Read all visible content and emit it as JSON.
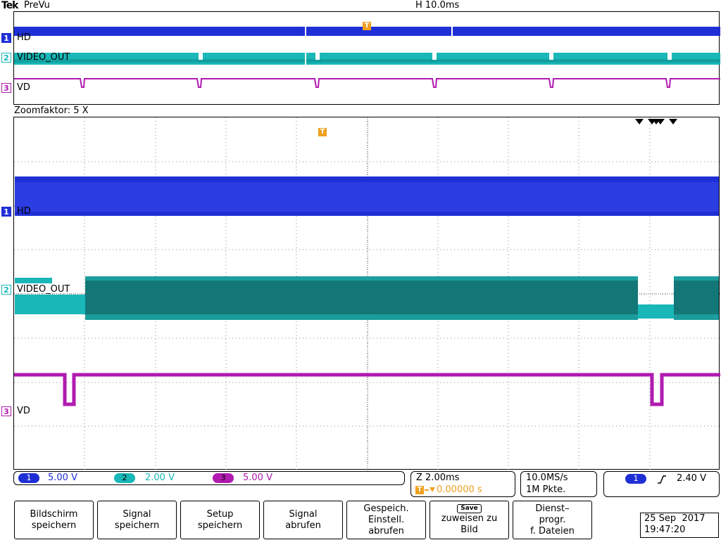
{
  "header": {
    "brand": "Tek",
    "mode": "PreVu",
    "horizontal_scale": "H 10.0ms"
  },
  "overview": {
    "channels": [
      {
        "badge": "1",
        "label": "HD",
        "color": "#1f2fd6"
      },
      {
        "badge": "2",
        "label": "VIDEO_OUT",
        "color": "#19b7b7"
      },
      {
        "badge": "3",
        "label": "VD",
        "color": "#b01ab0"
      }
    ],
    "trigger_marker": "T"
  },
  "zoom": {
    "label": "Zoomfaktor: 5 X",
    "trigger_marker": "T",
    "channels": [
      {
        "badge": "1",
        "label": "HD",
        "color": "#1f2fd6"
      },
      {
        "badge": "2",
        "label": "VIDEO_OUT",
        "color": "#19b7b7"
      },
      {
        "badge": "3",
        "label": "VD",
        "color": "#b01ab0"
      }
    ]
  },
  "channel_bar": [
    {
      "num": "1",
      "value": "5.00 V",
      "color": "#1f2fd6"
    },
    {
      "num": "2",
      "value": "2.00 V",
      "color": "#19b7b7"
    },
    {
      "num": "3",
      "value": "5.00 V",
      "color": "#b01ab0"
    }
  ],
  "zoom_box": {
    "line1": "Z 2.00ms",
    "trigger_marker": "T",
    "line2": "0.00000 s",
    "line2_color": "#f0a020"
  },
  "sample_box": {
    "rate": "10.0MS/s",
    "points": "1M Pkte."
  },
  "trigger_box": {
    "channel": "1",
    "slope_icon": "rising-edge-icon",
    "level": "2.40 V"
  },
  "menu_buttons": [
    {
      "line1": "Bildschirm",
      "line2": "speichern",
      "line3": ""
    },
    {
      "line1": "Signal",
      "line2": "speichern",
      "line3": ""
    },
    {
      "line1": "Setup",
      "line2": "speichern",
      "line3": ""
    },
    {
      "line1": "Signal",
      "line2": "abrufen",
      "line3": ""
    },
    {
      "line1": "Gespeich.",
      "line2": "Einstell.",
      "line3": "abrufen"
    },
    {
      "line1": "Save",
      "line2": "zuweisen zu",
      "line3": "Bild"
    },
    {
      "line1": "Dienst–",
      "line2": "progr.",
      "line3": "f. Dateien"
    }
  ],
  "datetime": {
    "date": "25 Sep  2017",
    "time": "19:47:20"
  }
}
